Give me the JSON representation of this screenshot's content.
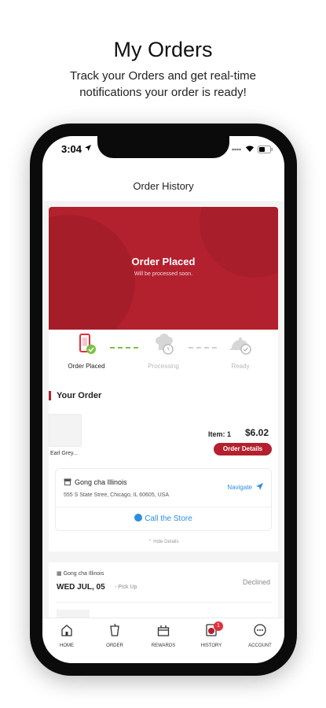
{
  "promo": {
    "title": "My Orders",
    "subtitle": "Track your Orders and get real-time notifications your order is ready!"
  },
  "status_bar": {
    "time": "3:04"
  },
  "header": {
    "title": "Order History"
  },
  "hero": {
    "title": "Order Placed",
    "subtitle": "Will be processed soon."
  },
  "steps": [
    {
      "label": "Order Placed",
      "state": "done"
    },
    {
      "label": "Processing",
      "state": "pending"
    },
    {
      "label": "Ready",
      "state": "pending"
    }
  ],
  "current_order": {
    "heading": "Your Order",
    "item_name": "Earl Grey...",
    "item_count": "Item: 1",
    "price": "$6.02",
    "details_button": "Order Details",
    "store_name": "Gong cha Illinois",
    "store_address": "555 S State Stree, Chicago, IL 60605, USA",
    "navigate": "Navigate",
    "call": "Call the Store",
    "hide_details": "Hide Details"
  },
  "past_order": {
    "store_name": "Gong cha Illinois",
    "date": "WED JUL, 05",
    "type": "- Pick Up",
    "status": "Declined"
  },
  "tabs": [
    {
      "label": "HOME",
      "icon": "home-icon"
    },
    {
      "label": "ORDER",
      "icon": "cup-icon"
    },
    {
      "label": "REWARDS",
      "icon": "gift-icon"
    },
    {
      "label": "HISTORY",
      "icon": "history-icon",
      "badge": "1"
    },
    {
      "label": "ACCOUNT",
      "icon": "account-icon"
    }
  ],
  "colors": {
    "accent": "#b3202e",
    "link": "#2b8fe0",
    "progress": "#7bc142",
    "badge": "#e0303c"
  }
}
